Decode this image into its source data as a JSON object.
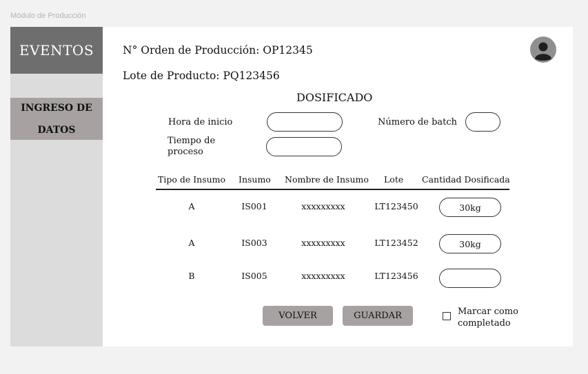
{
  "frame": {
    "title": "Módulo de Producción"
  },
  "sidebar": {
    "brand": "EVENTOS",
    "items": [
      {
        "label": "INGRESO DE DATOS"
      }
    ]
  },
  "header": {
    "order_label": "N° Orden de Producción: OP12345",
    "lot_label": "Lote de Producto: PQ123456",
    "avatar_icon": "user-avatar-icon"
  },
  "form": {
    "section_title": "DOSIFICADO",
    "start_time": {
      "label": "Hora de inicio",
      "value": ""
    },
    "process_time": {
      "label": "Tiempo de proceso",
      "value": ""
    },
    "batch_number": {
      "label": "Número de batch",
      "value": ""
    }
  },
  "table": {
    "headers": [
      "Tipo de Insumo",
      "Insumo",
      "Nombre de Insumo",
      "Lote",
      "Cantidad Dosificada"
    ],
    "rows": [
      {
        "tipo": "A",
        "insumo": "IS001",
        "nombre": "xxxxxxxxx",
        "lote": "LT123450",
        "cantidad": "30kg"
      },
      {
        "tipo": "A",
        "insumo": "IS003",
        "nombre": "xxxxxxxxx",
        "lote": "LT123452",
        "cantidad": "30kg"
      },
      {
        "tipo": "B",
        "insumo": "IS005",
        "nombre": "xxxxxxxxx",
        "lote": "LT123456",
        "cantidad": ""
      }
    ]
  },
  "actions": {
    "back_label": "VOLVER",
    "save_label": "GUARDAR",
    "complete_label": "Marcar como completado",
    "complete_checked": false
  },
  "colors": {
    "brand_bg": "#6e6e6e",
    "sidebar_bg": "#dcdcdc",
    "active_item_bg": "#a7a1a1",
    "button_bg": "#a7a1a1"
  }
}
